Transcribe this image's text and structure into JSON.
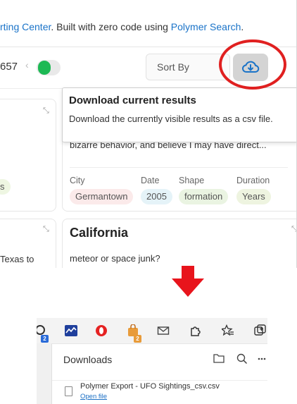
{
  "footer": {
    "part1": "rting Center",
    "part2": ". Built with zero code using ",
    "link": "Polymer Search",
    "part3": "."
  },
  "toolbar": {
    "count": "657",
    "sort_label": "Sort By",
    "download_icon": "cloud-download-icon",
    "toggle_on": true
  },
  "tooltip": {
    "title": "Download current results",
    "body": "Download the currently visible results as a csv file."
  },
  "cards": {
    "left1_chip": "s",
    "left2_text": "Texas to",
    "right1_text": "bizarre behavior, and believe I may have direct...",
    "right1_fields": [
      {
        "label": "City",
        "value": "Germantown"
      },
      {
        "label": "Date",
        "value": "2005"
      },
      {
        "label": "Shape",
        "value": "formation"
      },
      {
        "label": "Duration",
        "value": "Years"
      }
    ],
    "right2_title": "California",
    "right2_text": "meteor or space junk?"
  },
  "browser": {
    "extensions": [
      "extension-2-icon",
      "chart-icon",
      "opera-icon",
      "shop-icon",
      "mail-icon",
      "puzzle-icon",
      "favorites-icon",
      "collections-icon"
    ],
    "badges": [
      "2",
      "2"
    ],
    "downloads_title": "Downloads",
    "file_name": "Polymer Export - UFO Sightings_csv.csv",
    "open_file": "Open file"
  },
  "colors": {
    "accent": "#1a73c8",
    "highlight": "#e02020",
    "toggle": "#1db954"
  }
}
